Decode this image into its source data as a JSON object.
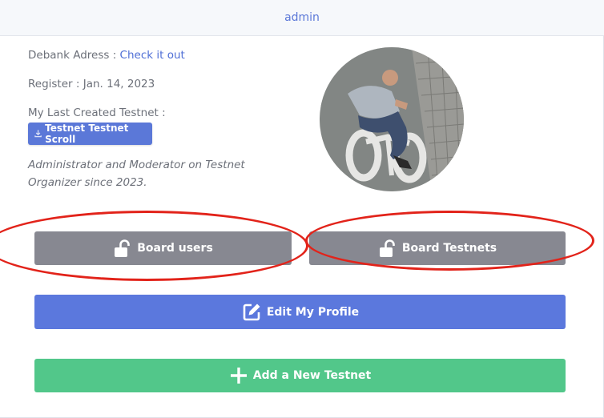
{
  "header": {
    "title": "admin"
  },
  "profile": {
    "debank_label": "Debank Adress : ",
    "debank_link": "Check it out",
    "register_text": "Register : Jan. 14, 2023",
    "last_testnet_label": "My Last Created Testnet :",
    "last_testnet_button": "Testnet Testnet Scroll",
    "bio_line1": "Administrator and Moderator on Testnet",
    "bio_line2": "Organizer since 2023."
  },
  "actions": {
    "board_users": "Board users",
    "board_testnets": "Board Testnets",
    "edit_profile": "Edit My Profile",
    "add_testnet": "Add a New Testnet"
  },
  "colors": {
    "accent": "#5b78d8",
    "gray_button": "#878891",
    "green_button": "#52c78a",
    "annotation_red": "#e2231a"
  },
  "icons": {
    "download": "download-icon",
    "unlock": "unlock-icon",
    "edit": "edit-icon",
    "plus": "plus-icon"
  }
}
